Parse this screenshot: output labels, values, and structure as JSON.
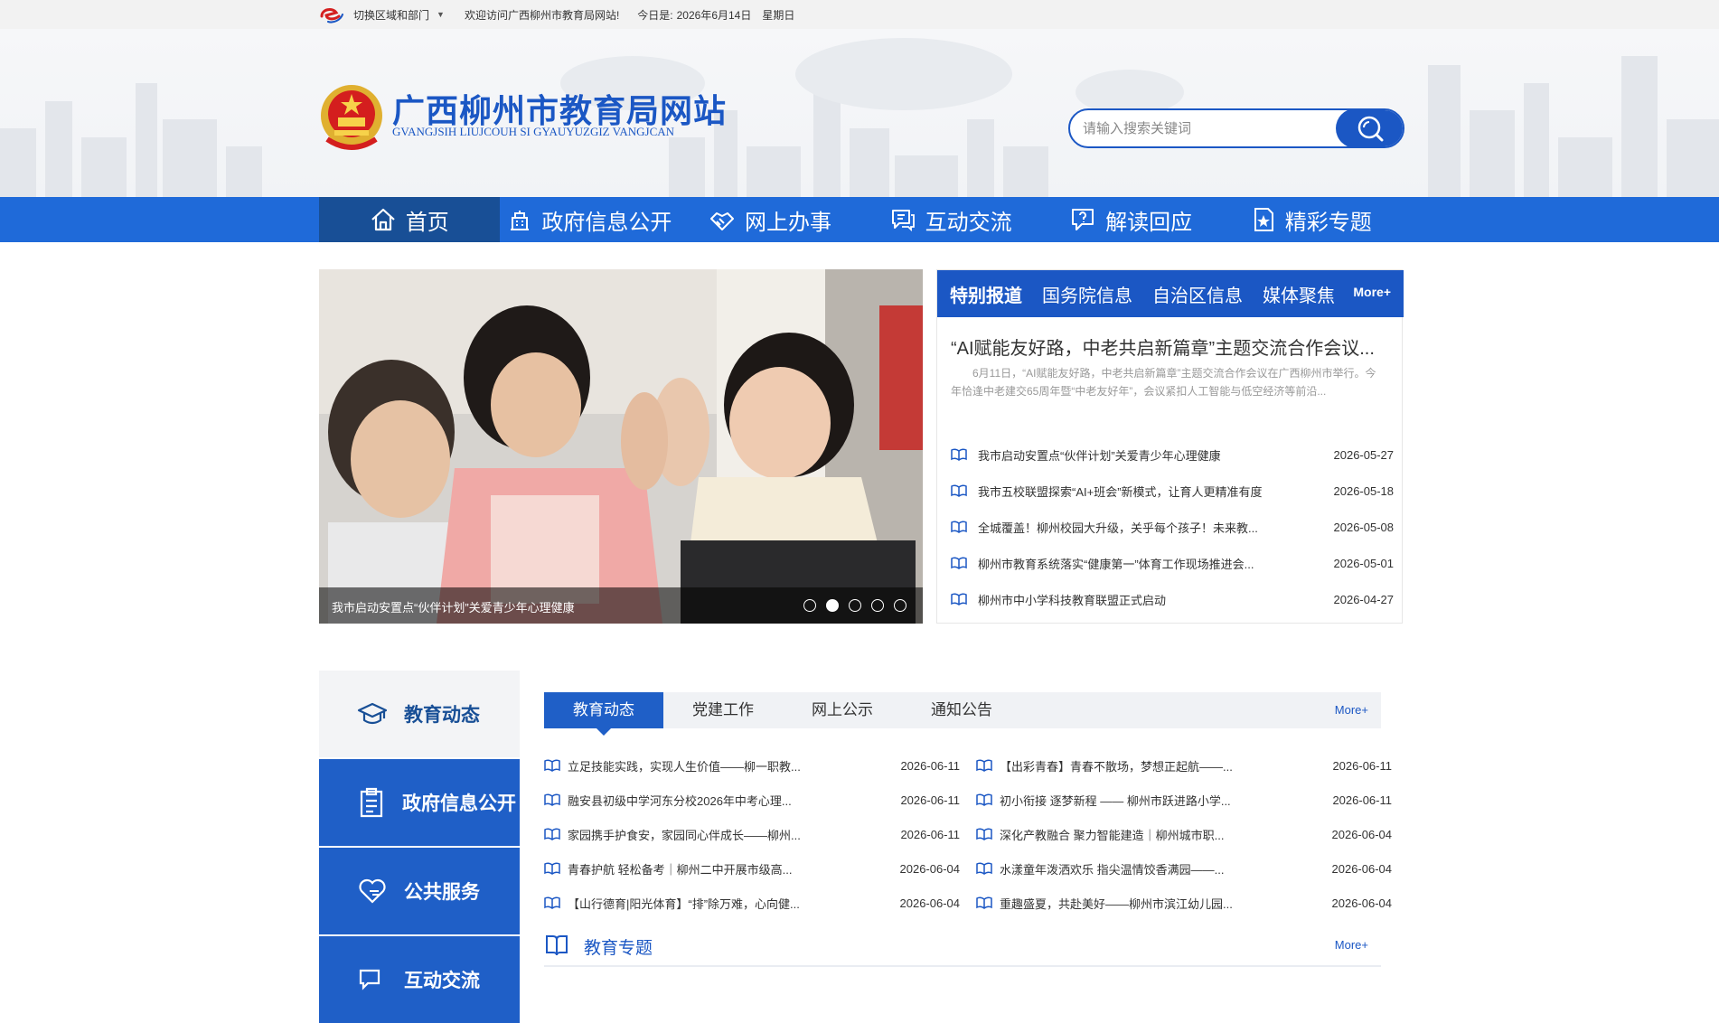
{
  "topbar": {
    "region_label": "切换区域和部门",
    "welcome": "欢迎访问广西柳州市教育局网站!",
    "date_label": "今日是:",
    "date_value": "2026年6月14日",
    "weekday": "星期日"
  },
  "header": {
    "title": "广西柳州市教育局网站",
    "subtitle": "GVANGJSIH LIUJCOUH SI GYAUYUZGIZ VANGJCAN",
    "search_placeholder": "请输入搜索关键词"
  },
  "nav": {
    "items": [
      {
        "label": "首页",
        "icon": "home-icon"
      },
      {
        "label": "政府信息公开",
        "icon": "building-icon"
      },
      {
        "label": "网上办事",
        "icon": "handshake-icon"
      },
      {
        "label": "互动交流",
        "icon": "chat-icon"
      },
      {
        "label": "解读回应",
        "icon": "question-chat-icon"
      },
      {
        "label": "精彩专题",
        "icon": "star-document-icon"
      }
    ]
  },
  "banner": {
    "caption": "我市启动安置点“伙伴计划”关爱青少年心理健康",
    "slide_count": 5,
    "active_slide": 2
  },
  "news": {
    "tabs": [
      "特别报道",
      "国务院信息",
      "自治区信息",
      "媒体聚焦"
    ],
    "more": "More+",
    "headline": "“AI赋能友好路，中老共启新篇章”主题交流合作会议...",
    "summary": "6月11日，“AI赋能友好路，中老共启新篇章”主题交流合作会议在广西柳州市举行。今年恰逢中老建交65周年暨“中老友好年”，会议紧扣人工智能与低空经济等前沿...",
    "items": [
      {
        "title": "我市启动安置点“伙伴计划”关爱青少年心理健康",
        "date": "2026-05-27"
      },
      {
        "title": "我市五校联盟探索“AI+班会”新模式，让育人更精准有度",
        "date": "2026-05-18"
      },
      {
        "title": "全城覆盖！柳州校园大升级，关乎每个孩子！未来教...",
        "date": "2026-05-08"
      },
      {
        "title": "柳州市教育系统落实“健康第一”体育工作现场推进会...",
        "date": "2026-05-01"
      },
      {
        "title": "柳州市中小学科技教育联盟正式启动",
        "date": "2026-04-27"
      }
    ]
  },
  "sidebar": {
    "items": [
      {
        "label": "教育动态",
        "icon": "graduation-cap-icon"
      },
      {
        "label": "政府信息公开",
        "icon": "clipboard-icon"
      },
      {
        "label": "公共服务",
        "icon": "heart-hand-icon"
      },
      {
        "label": "互动交流",
        "icon": "chat-icon"
      }
    ]
  },
  "content": {
    "tabs": [
      "教育动态",
      "党建工作",
      "网上公示",
      "通知公告"
    ],
    "more": "More+",
    "left": [
      {
        "title": "立足技能实践，实现人生价值——柳一职教...",
        "date": "2026-06-11"
      },
      {
        "title": "融安县初级中学河东分校2026年中考心理...",
        "date": "2026-06-11"
      },
      {
        "title": "家园携手护食安，家园同心伴成长——柳州...",
        "date": "2026-06-11"
      },
      {
        "title": "青春护航 轻松备考｜柳州二中开展市级高...",
        "date": "2026-06-04"
      },
      {
        "title": "【山行德育|阳光体育】“排”除万难，心向健...",
        "date": "2026-06-04"
      }
    ],
    "right": [
      {
        "title": "【出彩青春】青春不散场，梦想正起航——...",
        "date": "2026-06-11"
      },
      {
        "title": "初小衔接 逐梦新程 —— 柳州市跃进路小学...",
        "date": "2026-06-11"
      },
      {
        "title": "深化产教融合 聚力智能建造｜柳州城市职...",
        "date": "2026-06-04"
      },
      {
        "title": "水漾童年泼洒欢乐 指尖温情饺香满园——...",
        "date": "2026-06-04"
      },
      {
        "title": "重趣盛夏，共赴美好——柳州市滨江幼儿园...",
        "date": "2026-06-04"
      }
    ],
    "topics_title": "教育专题",
    "topics_more": "More+"
  },
  "colors": {
    "brand_blue": "#1b57c4",
    "nav_blue": "#1f6ad9",
    "nav_active": "#184f96"
  }
}
